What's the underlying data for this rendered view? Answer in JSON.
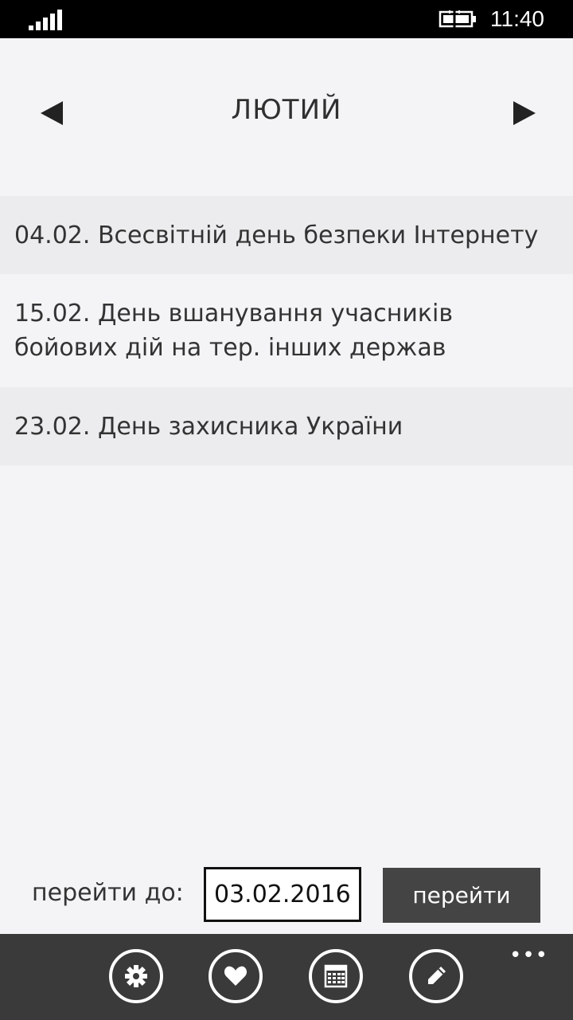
{
  "status_bar": {
    "time": "11:40",
    "signal_icon": "signal-bars-icon",
    "battery_icon": "battery-charging-icon"
  },
  "header": {
    "month": "ЛЮТИЙ",
    "prev_icon": "triangle-left-icon",
    "next_icon": "triangle-right-icon"
  },
  "holidays": [
    {
      "text": "04.02. Всесвітній день безпеки Інтернету"
    },
    {
      "text": "15.02. День вшанування учасників бойових дій на тер. інших держав"
    },
    {
      "text": "23.02. День захисника України"
    }
  ],
  "goto": {
    "label": "перейти до:",
    "value": "03.02.2016",
    "button_label": "перейти"
  },
  "app_bar": {
    "more": "•••",
    "buttons": [
      {
        "icon": "gear-icon"
      },
      {
        "icon": "heart-icon"
      },
      {
        "icon": "calendar-icon"
      },
      {
        "icon": "pencil-icon"
      }
    ]
  },
  "colors": {
    "background": "#f4f4f6",
    "row_alt": "#ececee",
    "app_bar": "#3a3a3a",
    "button": "#444444"
  }
}
